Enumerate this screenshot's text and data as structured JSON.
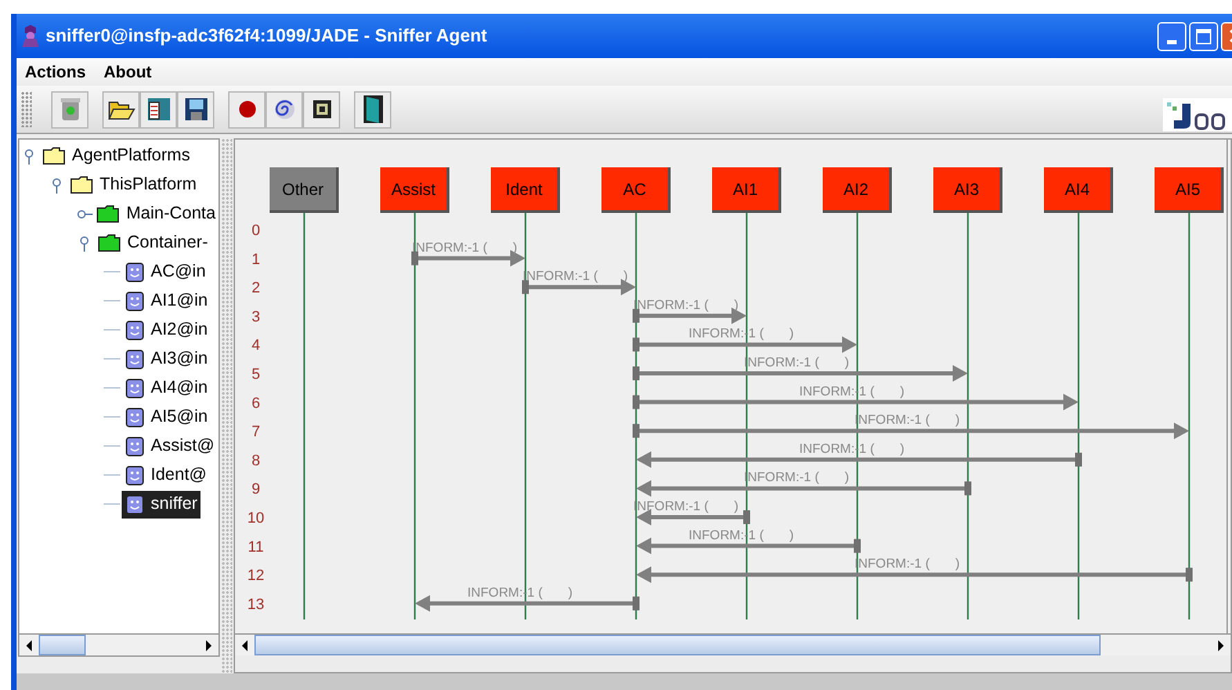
{
  "window": {
    "title": "sniffer0@insfp-adc3f62f4:1099/JADE - Sniffer Agent"
  },
  "menu": [
    {
      "label": "Actions"
    },
    {
      "label": "About"
    }
  ],
  "tree": [
    {
      "label": "AgentPlatforms",
      "kind": "platform",
      "expanded": true,
      "selected": false,
      "children": [
        {
          "label": "ThisPlatform",
          "kind": "platform",
          "expanded": true,
          "selected": false,
          "children": [
            {
              "label": "Main-Conta",
              "kind": "container",
              "expanded": false,
              "selected": false
            },
            {
              "label": "Container-",
              "kind": "container",
              "expanded": true,
              "selected": false,
              "children": [
                {
                  "label": "AC@in",
                  "kind": "agent",
                  "selected": false
                },
                {
                  "label": "AI1@in",
                  "kind": "agent",
                  "selected": false
                },
                {
                  "label": "AI2@in",
                  "kind": "agent",
                  "selected": false
                },
                {
                  "label": "AI3@in",
                  "kind": "agent",
                  "selected": false
                },
                {
                  "label": "AI4@in",
                  "kind": "agent",
                  "selected": false
                },
                {
                  "label": "AI5@in",
                  "kind": "agent",
                  "selected": false
                },
                {
                  "label": "Assist@",
                  "kind": "agent",
                  "selected": false
                },
                {
                  "label": "Ident@",
                  "kind": "agent",
                  "selected": false
                },
                {
                  "label": "sniffer",
                  "kind": "agent",
                  "selected": true
                }
              ]
            }
          ]
        }
      ]
    }
  ],
  "agents": [
    {
      "name": "Other",
      "color": "#808080"
    },
    {
      "name": "Assist",
      "color": "#ff2a00"
    },
    {
      "name": "Ident",
      "color": "#ff2a00"
    },
    {
      "name": "AC",
      "color": "#ff2a00"
    },
    {
      "name": "AI1",
      "color": "#ff2a00"
    },
    {
      "name": "AI2",
      "color": "#ff2a00"
    },
    {
      "name": "AI3",
      "color": "#ff2a00"
    },
    {
      "name": "AI4",
      "color": "#ff2a00"
    },
    {
      "name": "AI5",
      "color": "#ff2a00"
    }
  ],
  "rows": [
    {
      "number": "0"
    },
    {
      "number": "1",
      "message": {
        "label": "INFORM:-1 (       )",
        "lanes": [
          {
            "kind": "none"
          },
          {
            "kind": "start"
          },
          {
            "kind": "end"
          },
          {
            "kind": "none"
          },
          {
            "kind": "none"
          },
          {
            "kind": "none"
          },
          {
            "kind": "none"
          },
          {
            "kind": "none"
          },
          {
            "kind": "none"
          }
        ]
      }
    },
    {
      "number": "2",
      "message": {
        "label": "INFORM:-1 (       )",
        "lanes": [
          {
            "kind": "none"
          },
          {
            "kind": "none"
          },
          {
            "kind": "start"
          },
          {
            "kind": "end"
          },
          {
            "kind": "none"
          },
          {
            "kind": "none"
          },
          {
            "kind": "none"
          },
          {
            "kind": "none"
          },
          {
            "kind": "none"
          }
        ]
      }
    },
    {
      "number": "3",
      "message": {
        "label": "INFORM:-1 (       )",
        "lanes": [
          {
            "kind": "none"
          },
          {
            "kind": "none"
          },
          {
            "kind": "none"
          },
          {
            "kind": "start"
          },
          {
            "kind": "end"
          },
          {
            "kind": "none"
          },
          {
            "kind": "none"
          },
          {
            "kind": "none"
          },
          {
            "kind": "none"
          }
        ]
      }
    },
    {
      "number": "4",
      "message": {
        "label": "INFORM:-1 (       )",
        "lanes": [
          {
            "kind": "none"
          },
          {
            "kind": "none"
          },
          {
            "kind": "none"
          },
          {
            "kind": "start"
          },
          {
            "kind": "none"
          },
          {
            "kind": "end"
          },
          {
            "kind": "none"
          },
          {
            "kind": "none"
          },
          {
            "kind": "none"
          }
        ]
      }
    },
    {
      "number": "5",
      "message": {
        "label": "INFORM:-1 (       )",
        "lanes": [
          {
            "kind": "none"
          },
          {
            "kind": "none"
          },
          {
            "kind": "none"
          },
          {
            "kind": "start"
          },
          {
            "kind": "none"
          },
          {
            "kind": "none"
          },
          {
            "kind": "end"
          },
          {
            "kind": "none"
          },
          {
            "kind": "none"
          }
        ]
      }
    },
    {
      "number": "6",
      "message": {
        "label": "INFORM:-1 (       )",
        "lanes": [
          {
            "kind": "none"
          },
          {
            "kind": "none"
          },
          {
            "kind": "none"
          },
          {
            "kind": "start"
          },
          {
            "kind": "none"
          },
          {
            "kind": "none"
          },
          {
            "kind": "none"
          },
          {
            "kind": "end"
          },
          {
            "kind": "none"
          }
        ]
      }
    },
    {
      "number": "7",
      "message": {
        "label": "INFORM:-1 (       )",
        "lanes": [
          {
            "kind": "none"
          },
          {
            "kind": "none"
          },
          {
            "kind": "none"
          },
          {
            "kind": "start"
          },
          {
            "kind": "none"
          },
          {
            "kind": "none"
          },
          {
            "kind": "none"
          },
          {
            "kind": "none"
          },
          {
            "kind": "end"
          }
        ]
      }
    },
    {
      "number": "8",
      "message": {
        "label": "INFORM:-1 (       )",
        "lanes": [
          {
            "kind": "none"
          },
          {
            "kind": "none"
          },
          {
            "kind": "none"
          },
          {
            "kind": "end"
          },
          {
            "kind": "none"
          },
          {
            "kind": "none"
          },
          {
            "kind": "none"
          },
          {
            "kind": "start"
          },
          {
            "kind": "none"
          }
        ]
      }
    },
    {
      "number": "9",
      "message": {
        "label": "INFORM:-1 (       )",
        "lanes": [
          {
            "kind": "none"
          },
          {
            "kind": "none"
          },
          {
            "kind": "none"
          },
          {
            "kind": "end"
          },
          {
            "kind": "none"
          },
          {
            "kind": "none"
          },
          {
            "kind": "start"
          },
          {
            "kind": "none"
          },
          {
            "kind": "none"
          }
        ]
      }
    },
    {
      "number": "10",
      "message": {
        "label": "INFORM:-1 (       )",
        "lanes": [
          {
            "kind": "none"
          },
          {
            "kind": "none"
          },
          {
            "kind": "none"
          },
          {
            "kind": "end"
          },
          {
            "kind": "start"
          },
          {
            "kind": "none"
          },
          {
            "kind": "none"
          },
          {
            "kind": "none"
          },
          {
            "kind": "none"
          }
        ]
      }
    },
    {
      "number": "11",
      "message": {
        "label": "INFORM:-1 (       )",
        "lanes": [
          {
            "kind": "none"
          },
          {
            "kind": "none"
          },
          {
            "kind": "none"
          },
          {
            "kind": "end"
          },
          {
            "kind": "none"
          },
          {
            "kind": "start"
          },
          {
            "kind": "none"
          },
          {
            "kind": "none"
          },
          {
            "kind": "none"
          }
        ]
      }
    },
    {
      "number": "12",
      "message": {
        "label": "INFORM:-1 (       )",
        "lanes": [
          {
            "kind": "none"
          },
          {
            "kind": "none"
          },
          {
            "kind": "none"
          },
          {
            "kind": "end"
          },
          {
            "kind": "none"
          },
          {
            "kind": "none"
          },
          {
            "kind": "none"
          },
          {
            "kind": "none"
          },
          {
            "kind": "start"
          }
        ]
      }
    },
    {
      "number": "13",
      "message": {
        "label": "INFORM:-1 (       )",
        "lanes": [
          {
            "kind": "none"
          },
          {
            "kind": "end"
          },
          {
            "kind": "none"
          },
          {
            "kind": "start"
          },
          {
            "kind": "none"
          },
          {
            "kind": "none"
          },
          {
            "kind": "none"
          },
          {
            "kind": "none"
          },
          {
            "kind": "none"
          }
        ]
      }
    }
  ]
}
